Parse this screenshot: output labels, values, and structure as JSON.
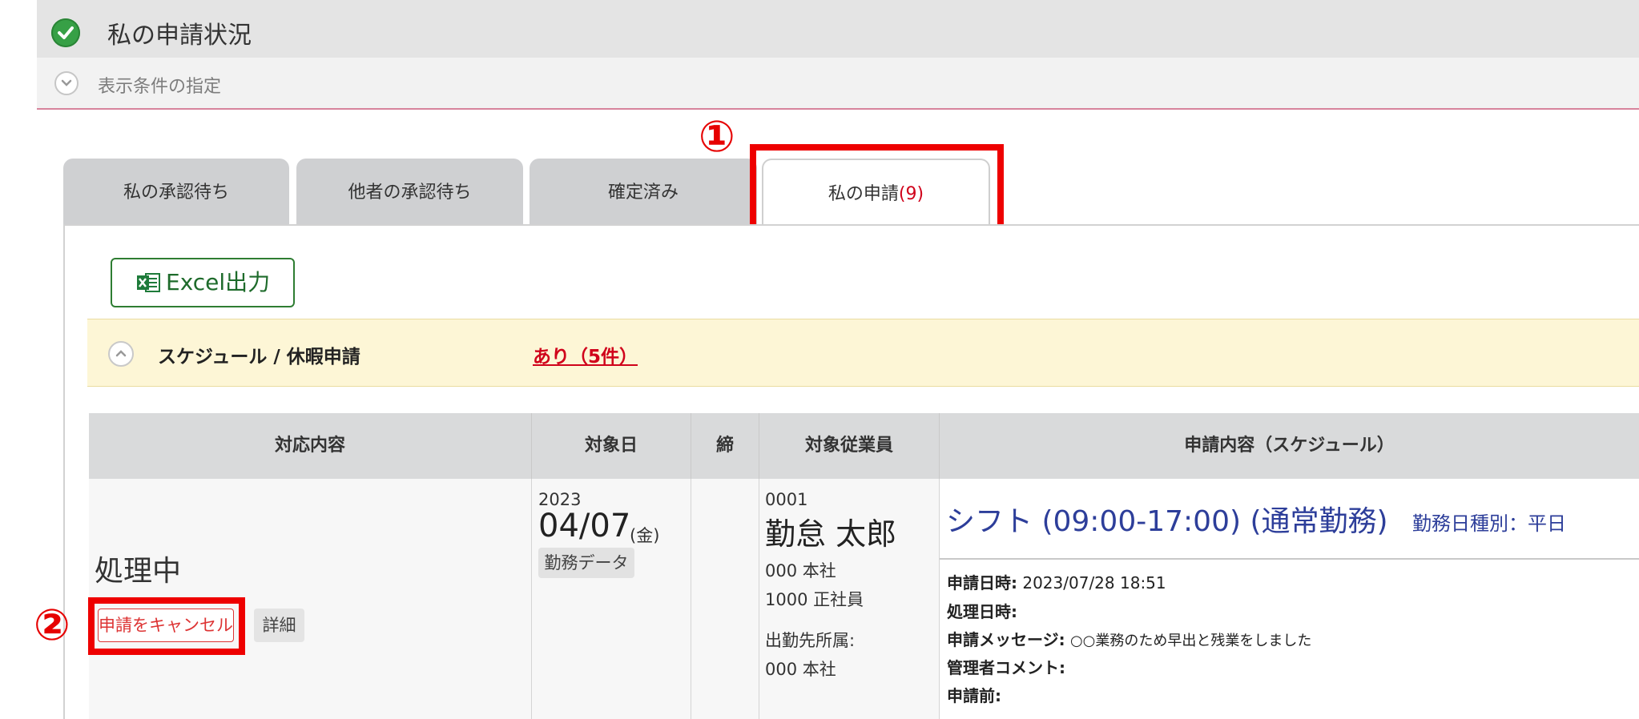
{
  "header": {
    "title": "私の申請状況"
  },
  "conditions": {
    "label": "表示条件の指定"
  },
  "callouts": [
    "①",
    "②"
  ],
  "tabs": [
    {
      "label": "私の承認待ち"
    },
    {
      "label": "他者の承認待ち"
    },
    {
      "label": "確定済み"
    },
    {
      "label": "私の申請",
      "count": "(9)",
      "active": true
    }
  ],
  "toolbar": {
    "excel_label": "Excel出力"
  },
  "section": {
    "title": "スケジュール / 休暇申請",
    "count_label": "あり（5件）"
  },
  "table": {
    "headers": [
      "対応内容",
      "対象日",
      "締",
      "対象従業員",
      "申請内容（スケジュール）"
    ],
    "row": {
      "status": "処理中",
      "cancel_label": "申請をキャンセル",
      "detail_label": "詳細",
      "year": "2023",
      "date": "04/07",
      "dow": "(金)",
      "work_data_label": "勤務データ",
      "emp_code": "0001",
      "emp_name": "勤怠 太郎",
      "dept": "000 本社",
      "position": "1000 正社員",
      "dispatch_label": "出勤先所属:",
      "dispatch_value": "000  本社",
      "shift": "シフト (09:00-17:00) (通常勤務)",
      "day_type": "勤務日種別：平日",
      "meta": {
        "applied_label": "申請日時:",
        "applied_value": "2023/07/28 18:51",
        "processed_label": "処理日時:",
        "message_label": "申請メッセージ:",
        "message_value": "○○業務のため早出と残業をしました",
        "admin_label": "管理者コメント:",
        "before_label": "申請前:"
      }
    }
  },
  "colors": {
    "accent_red": "#e60000",
    "shift_blue": "#2d3e9a",
    "excel_green": "#1e6b2b"
  }
}
